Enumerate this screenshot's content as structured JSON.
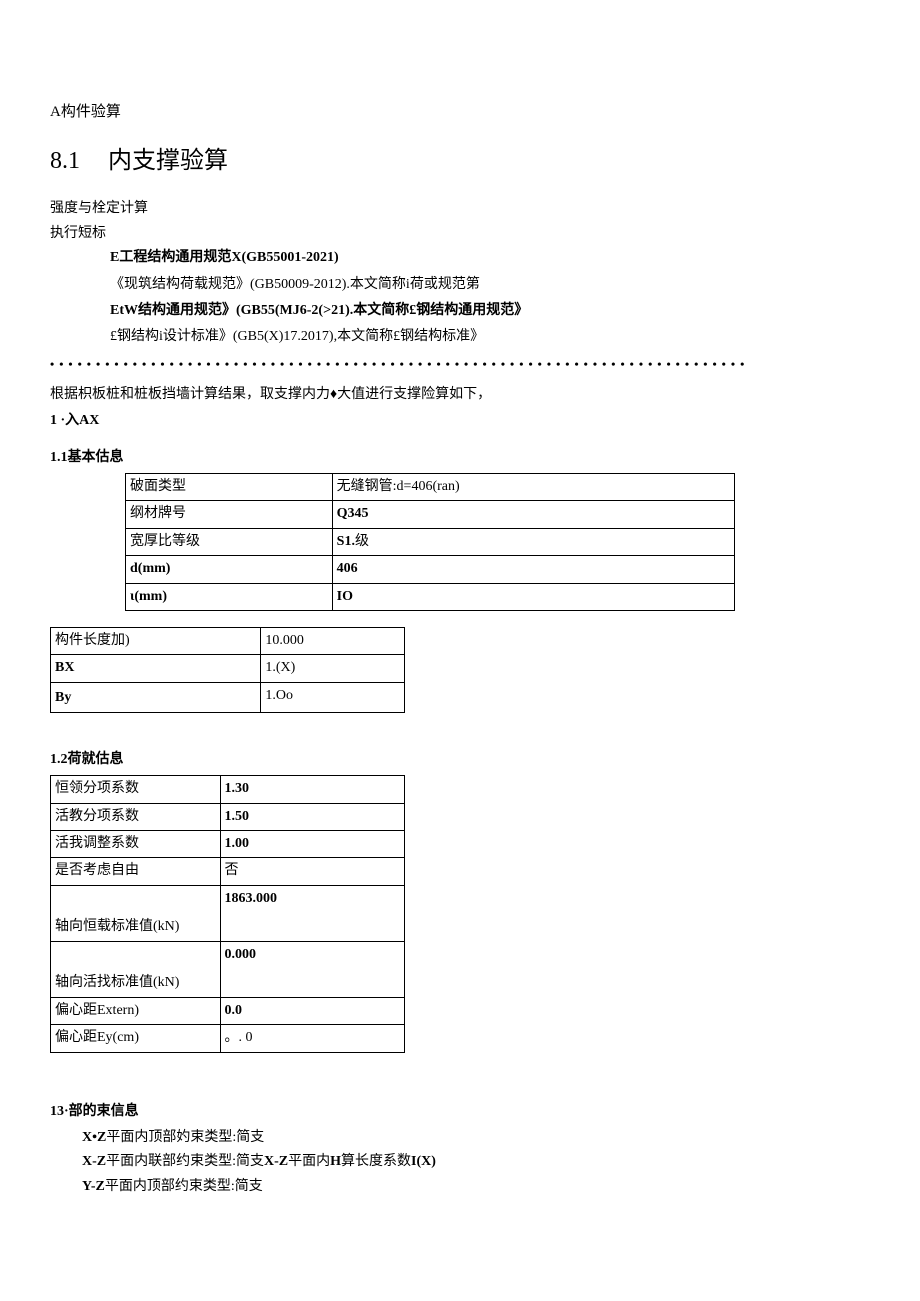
{
  "titleA": "A构件验算",
  "title81_num": "8.1",
  "title81_text": "内支撑验算",
  "subtitle": "强度与栓定计算",
  "exec_label": "执行短标",
  "standards": {
    "s1": "E工程结构通用规范X(GB55001-2021)",
    "s2": "《现筑结构荷载规范》(GB50009-2012).本文简称i荷或规范第",
    "s3": "EtW结构通用规范》(GB55(MJ6-2(>21).本文简称£钢结构通用规范》",
    "s4": "£钢结构i设计标准》(GB5(X)17.2017),本文简称£钢结构标准》"
  },
  "intro_para": "根据枳板桩和桩板挡墙计算结果，取支撑内力♦大值进行支撑险算如下，",
  "sec1": "1 ·入AX",
  "sec11": "1.1基本估息",
  "basic": {
    "r1k": "破面类型",
    "r1v": "无缝钢管:d=406(ran)",
    "r2k": "纲材牌号",
    "r2v": "Q345",
    "r3k": "宽厚比等级",
    "r3v": "S1.级",
    "r4k": "d(mm)",
    "r4v": "406",
    "r5k": "ι(mm)",
    "r5v": "IO"
  },
  "member": {
    "r1k": "构件长度加)",
    "r1v": "10.000",
    "r2k": "BX",
    "r2v": "1.(X)",
    "r3k": "By",
    "r3v": "1.Oo"
  },
  "sec12": "1.2荷就估息",
  "load": {
    "r1k": "恒领分项系数",
    "r1v": "1.30",
    "r2k": "活教分项系数",
    "r2v": "1.50",
    "r3k": "活我调整系数",
    "r3v": "1.00",
    "r4k": "是否考虑自由",
    "r4v": "否",
    "r5k": "轴向恒载标准值(kN)",
    "r5v": "1863.000",
    "r6k": "轴向活找标准值(kN)",
    "r6v": "0.000",
    "r7k": "偏心距Extern)",
    "r7v": "0.0",
    "r8k": "偏心距Ey(cm)",
    "r8v": "。. 0"
  },
  "sec13": "13·部的束信息",
  "constraints": {
    "c1": "X•Z平面内顶部妁束类型:简支",
    "c2": "X-Z平面内联部约束类型:简支X-Z平面内H算长度系数I(X)",
    "c3": "Y-Z平面内顶部约束类型:简支"
  }
}
